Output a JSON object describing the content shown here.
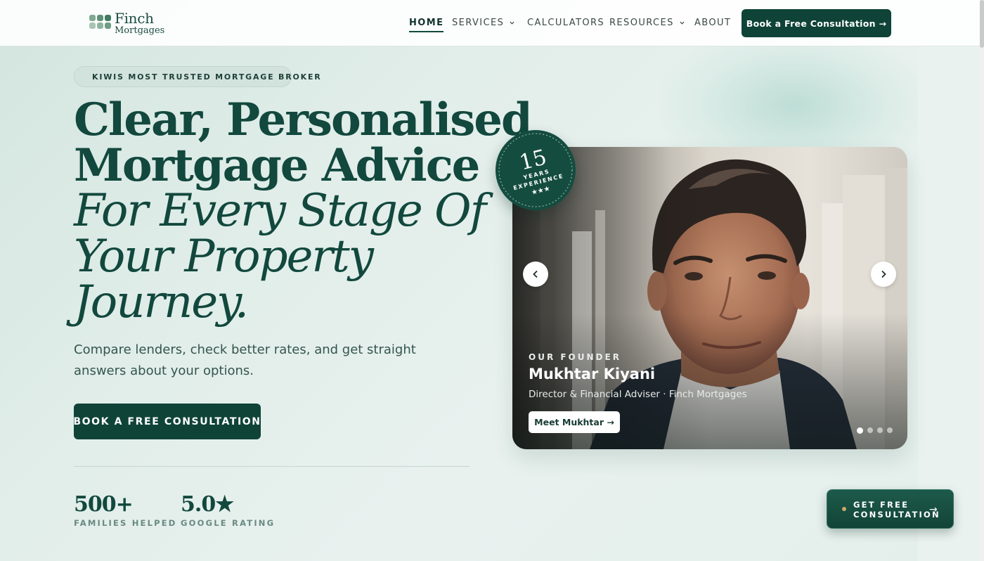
{
  "brand": {
    "name": "Finch",
    "subname": "Mortgages",
    "colors": {
      "primary": "#0f4338",
      "heading": "#12483d",
      "background": "#e2eeea",
      "accent_gold": "#c8a86a"
    }
  },
  "nav": {
    "items": [
      {
        "label": "HOME",
        "active": true,
        "has_dropdown": false
      },
      {
        "label": "SERVICES",
        "active": false,
        "has_dropdown": true
      },
      {
        "label": "CALCULATORS",
        "active": false,
        "has_dropdown": false
      },
      {
        "label": "RESOURCES",
        "active": false,
        "has_dropdown": true
      },
      {
        "label": "ABOUT",
        "active": false,
        "has_dropdown": false
      }
    ],
    "cta_label": "Book a Free Consultation →"
  },
  "hero": {
    "badge_icon": "award-ribbon-icon",
    "badge_text": "KIWIS MOST TRUSTED MORTGAGE BROKER",
    "headline_line1": "Clear, Personalised",
    "headline_line2": "Mortgage Advice",
    "headline_italic_line1": "For Every Stage Of",
    "headline_italic_line2": "Your Property",
    "headline_italic_line3": "Journey.",
    "lede": "Compare lenders, check better rates, and get straight answers about your options.",
    "cta_label": "BOOK A FREE CONSULTATION",
    "stats": [
      {
        "value": "500+",
        "label": "FAMILIES HELPED"
      },
      {
        "value": "5.0★",
        "label": "GOOGLE RATING"
      }
    ]
  },
  "seal": {
    "number": "15",
    "text": "YEARS EXPERIENCE",
    "stars": "★★★"
  },
  "founder_card": {
    "eyebrow": "OUR FOUNDER",
    "name": "Mukhtar Kiyani",
    "title": "Director & Financial Adviser · Finch Mortgages",
    "button_label": "Meet Mukhtar →",
    "prev_icon": "chevron-left-icon",
    "next_icon": "chevron-right-icon",
    "slide_count": 4,
    "active_slide": 1
  },
  "floating_cta": {
    "line1": "GET FREE",
    "line2": "CONSULTATION",
    "arrow": "→"
  }
}
